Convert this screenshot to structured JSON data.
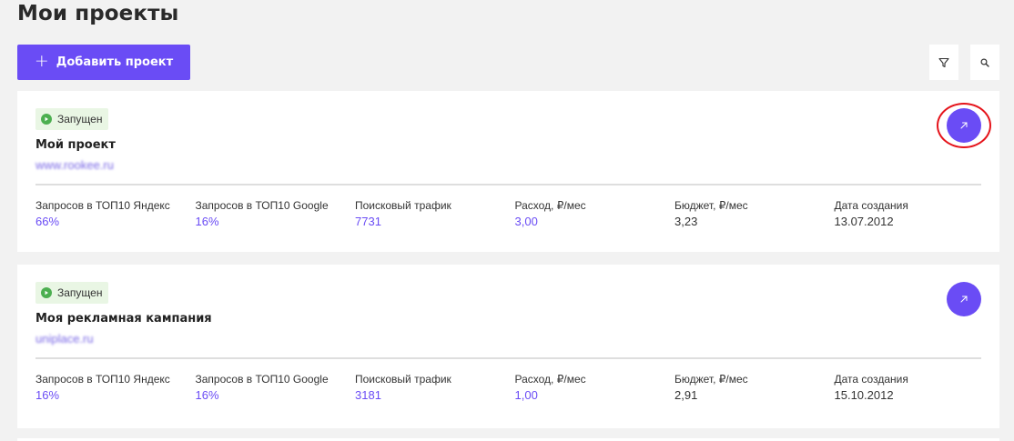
{
  "page": {
    "title": "Мои проекты"
  },
  "toolbar": {
    "add_button_icon": "+",
    "add_button_label": "Добавить проект",
    "filter_icon": "filter-icon",
    "search_icon": "search-icon"
  },
  "colors": {
    "accent": "#6a4cf5",
    "status_bg": "#e9f6e4",
    "status_icon": "#4caf50",
    "highlight": "#e5141b"
  },
  "projects": [
    {
      "status": "Запущен",
      "name": "Мой проект",
      "url": "www.rookee.ru",
      "stats": [
        {
          "label": "Запросов в ТОП10 Яндекс",
          "value": "66%"
        },
        {
          "label": "Запросов в ТОП10 Google",
          "value": "16%"
        },
        {
          "label": "Поисковый трафик",
          "value": "7731"
        },
        {
          "label": "Расход, ₽/мес",
          "value": "3,00"
        },
        {
          "label": "Бюджет, ₽/мес",
          "value": "3,23"
        },
        {
          "label": "Дата создания",
          "value": "13.07.2012"
        }
      ]
    },
    {
      "status": "Запущен",
      "name": "Моя рекламная кампания",
      "url": "uniplace.ru",
      "stats": [
        {
          "label": "Запросов в ТОП10 Яндекс",
          "value": "16%"
        },
        {
          "label": "Запросов в ТОП10 Google",
          "value": "16%"
        },
        {
          "label": "Поисковый трафик",
          "value": "3181"
        },
        {
          "label": "Расход, ₽/мес",
          "value": "1,00"
        },
        {
          "label": "Бюджет, ₽/мес",
          "value": "2,91"
        },
        {
          "label": "Дата создания",
          "value": "15.10.2012"
        }
      ]
    }
  ]
}
